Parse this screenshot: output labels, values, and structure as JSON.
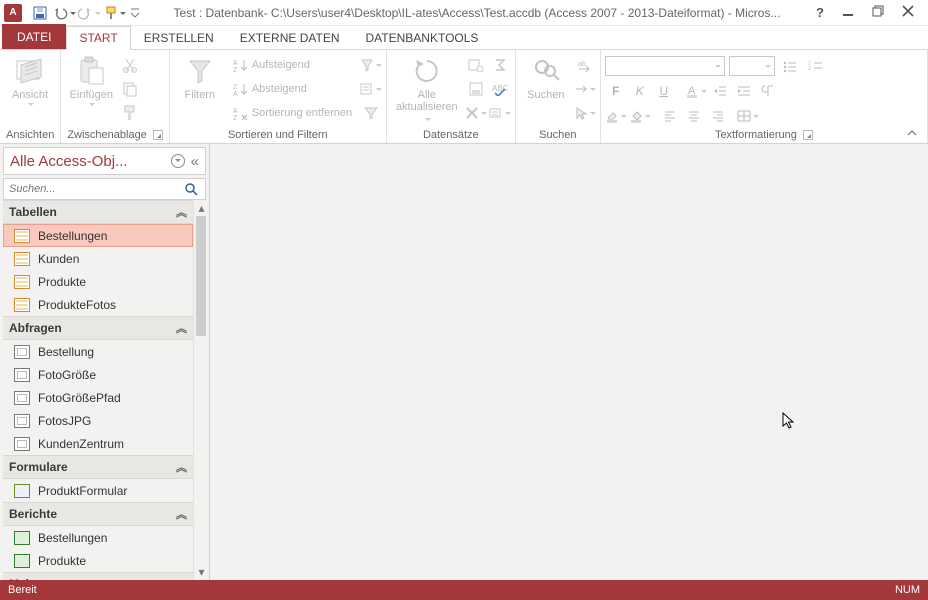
{
  "title": "Test : Datenbank- C:\\Users\\user4\\Desktop\\IL-ates\\Access\\Test.accdb (Access 2007 - 2013-Dateiformat) - Micros...",
  "tabs": {
    "file": "DATEI",
    "start": "START",
    "erstellen": "ERSTELLEN",
    "externe": "EXTERNE DATEN",
    "dbtools": "DATENBANKTOOLS"
  },
  "ribbon": {
    "ansichten": {
      "btn": "Ansicht",
      "label": "Ansichten"
    },
    "zwischenablage": {
      "einfuegen": "Einfügen",
      "label": "Zwischenablage"
    },
    "sortieren": {
      "filtern": "Filtern",
      "aufsteigend": "Aufsteigend",
      "absteigend": "Absteigend",
      "entfernen": "Sortierung entfernen",
      "label": "Sortieren und Filtern"
    },
    "datensaetze": {
      "aktualisieren_l1": "Alle",
      "aktualisieren_l2": "aktualisieren",
      "label": "Datensätze"
    },
    "suchen": {
      "btn": "Suchen",
      "label": "Suchen"
    },
    "text": {
      "label": "Textformatierung",
      "bold": "F",
      "italic": "K",
      "under": "U"
    }
  },
  "nav": {
    "title": "Alle Access-Obj...",
    "search_ph": "Suchen...",
    "sections": {
      "tabellen": "Tabellen",
      "abfragen": "Abfragen",
      "formulare": "Formulare",
      "berichte": "Berichte",
      "makros": "Makros"
    },
    "tabellen": [
      "Bestellungen",
      "Kunden",
      "Produkte",
      "ProdukteFotos"
    ],
    "abfragen": [
      "Bestellung",
      "FotoGröße",
      "FotoGrößePfad",
      "FotosJPG",
      "KundenZentrum"
    ],
    "formulare": [
      "ProduktFormular"
    ],
    "berichte": [
      "Bestellungen",
      "Produkte"
    ]
  },
  "status": {
    "left": "Bereit",
    "right": "NUM"
  }
}
